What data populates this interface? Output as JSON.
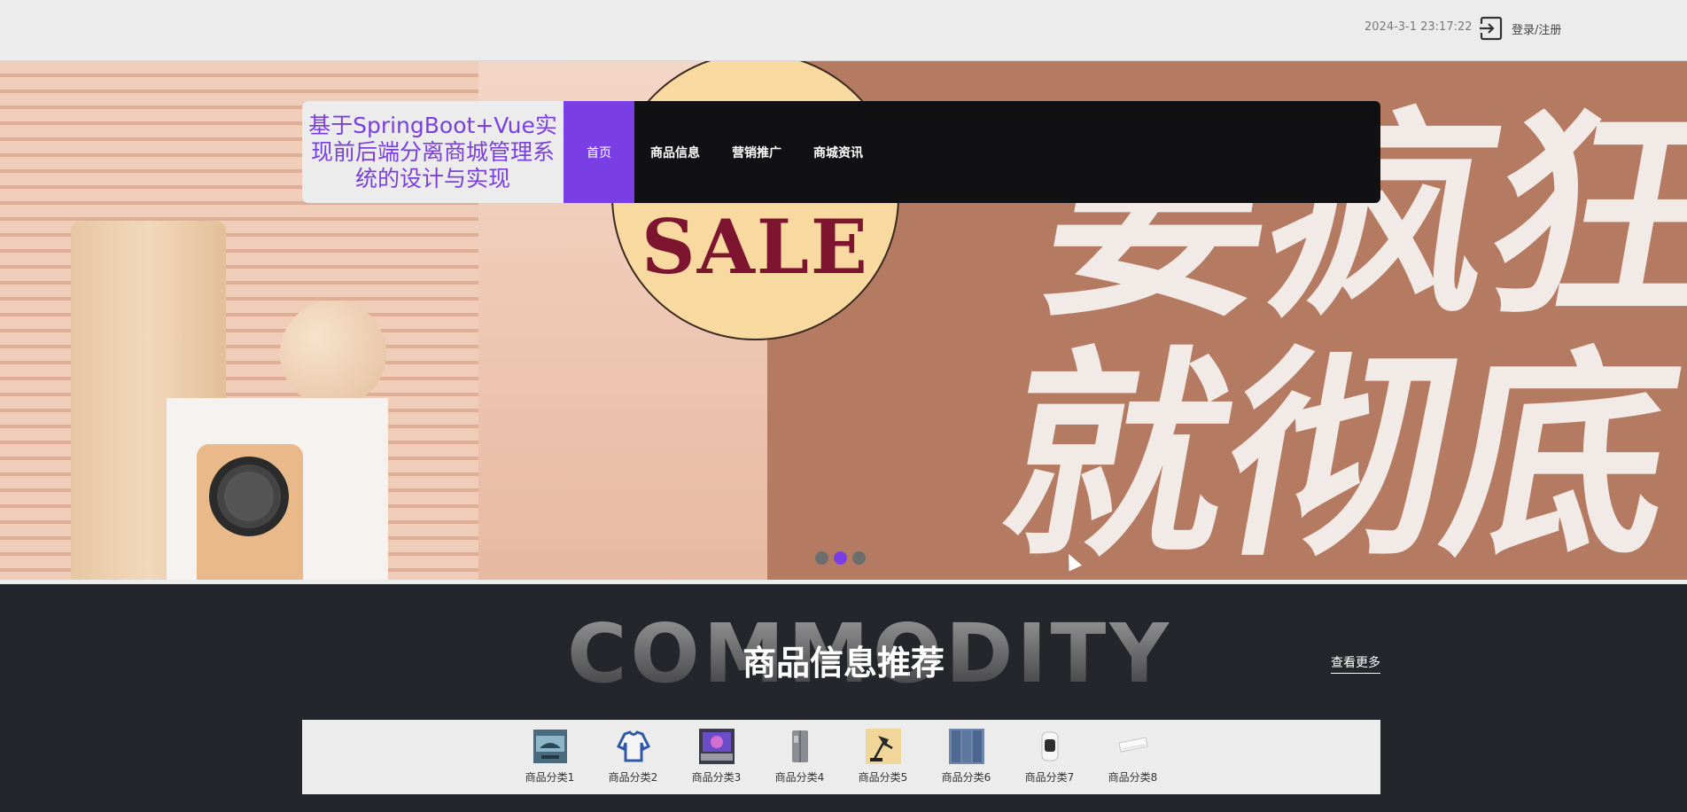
{
  "header": {
    "datetime": "2024-3-1 23:17:22",
    "login_label": "登录/注册"
  },
  "nav": {
    "brand": "基于SpringBoot+Vue实现前后端分离商城管理系统的设计与实现",
    "items": [
      {
        "label": "首页",
        "active": true
      },
      {
        "label": "商品信息"
      },
      {
        "label": "营销推广"
      },
      {
        "label": "商城资讯"
      }
    ]
  },
  "banner": {
    "sale_text": "SALE",
    "brush_text": "要疯狂\n就彻底",
    "slides": 3,
    "active_slide": 2
  },
  "commodity": {
    "bg_word": "COMMODITY",
    "title": "商品信息推荐",
    "more_label": "查看更多",
    "categories": [
      {
        "label": "商品分类1",
        "icon": "tv-icon"
      },
      {
        "label": "商品分类2",
        "icon": "shirt-icon"
      },
      {
        "label": "商品分类3",
        "icon": "laptop-icon"
      },
      {
        "label": "商品分类4",
        "icon": "fridge-icon"
      },
      {
        "label": "商品分类5",
        "icon": "lamp-icon"
      },
      {
        "label": "商品分类6",
        "icon": "jeans-icon"
      },
      {
        "label": "商品分类7",
        "icon": "heater-icon"
      },
      {
        "label": "商品分类8",
        "icon": "air-conditioner-icon"
      }
    ]
  },
  "colors": {
    "accent": "#7a3fe4",
    "dark": "#25262b",
    "nav_bg": "#111113"
  }
}
